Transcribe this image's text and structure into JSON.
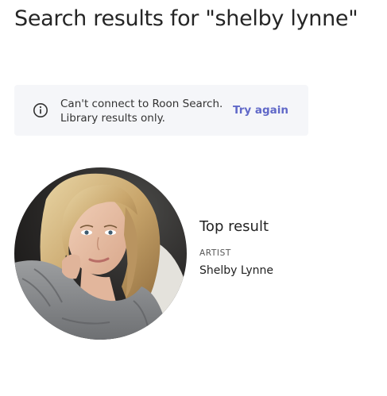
{
  "header": {
    "title": "Search results for \"shelby lynne\""
  },
  "notice": {
    "icon": "info-icon",
    "line1": "Can't connect to Roon Search.",
    "line2": "Library results only.",
    "action_label": "Try again",
    "accent_color": "#6068c8"
  },
  "top_result": {
    "heading": "Top result",
    "type_label": "ARTIST",
    "name": "Shelby Lynne"
  }
}
